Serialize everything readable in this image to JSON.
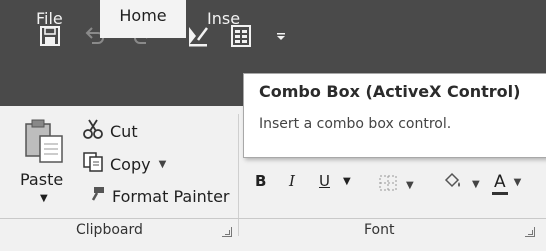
{
  "quick_access": {
    "icons": [
      "save-icon",
      "undo-icon",
      "redo-icon",
      "design-mode-icon",
      "form-icon",
      "customize-icon"
    ]
  },
  "tabs": [
    {
      "label": "File"
    },
    {
      "label": "Home"
    },
    {
      "label": "Inse"
    }
  ],
  "clipboard": {
    "paste_label": "Paste",
    "cut_label": "Cut",
    "copy_label": "Copy",
    "format_painter_label": "Format Painter",
    "group_label": "Clipboard"
  },
  "font": {
    "bold": "B",
    "italic": "I",
    "underline": "U",
    "font_color": "A",
    "group_label": "Font"
  },
  "tooltip": {
    "title": "Combo Box (ActiveX Control)",
    "description": "Insert a combo box control."
  }
}
